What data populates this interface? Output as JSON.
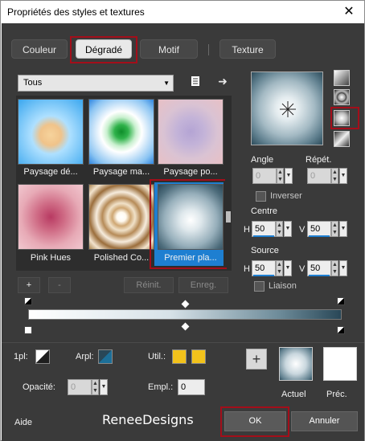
{
  "window": {
    "title": "Propriétés des styles et textures",
    "close_glyph": "✕"
  },
  "tabs": [
    {
      "label": "Couleur"
    },
    {
      "label": "Dégradé"
    },
    {
      "label": "Motif"
    },
    {
      "label": "Texture"
    }
  ],
  "category": {
    "selected": "Tous"
  },
  "gallery": [
    {
      "label": "Paysage dé..."
    },
    {
      "label": "Paysage ma..."
    },
    {
      "label": "Paysage po..."
    },
    {
      "label": "Pink Hues"
    },
    {
      "label": "Polished Co..."
    },
    {
      "label": "Premier pla..."
    }
  ],
  "gallery_buttons": {
    "add": "+",
    "remove": "-",
    "reset": "Réinit.",
    "save": "Enreg."
  },
  "settings": {
    "angle_label": "Angle",
    "angle_value": "0",
    "repeat_label": "Répét.",
    "repeat_value": "0",
    "invert_label": "Inverser",
    "centre_label": "Centre",
    "centre_h": "50",
    "centre_v": "50",
    "source_label": "Source",
    "source_h": "50",
    "source_v": "50",
    "link_label": "Liaison",
    "h": "H",
    "v": "V"
  },
  "bottom": {
    "stop_label": "1pl:",
    "back_label": "Arpl:",
    "util_label": "Util.:",
    "opacity_label": "Opacité:",
    "opacity_value": "0",
    "location_label": "Empl.:",
    "location_value": "0",
    "current_label": "Actuel",
    "previous_label": "Préc.",
    "add_glyph": "+",
    "help_label": "Aide",
    "watermark": "ReneeDesigns",
    "ok_label": "OK",
    "cancel_label": "Annuler"
  },
  "colors": {
    "highlight_red": "#a30e1a",
    "selection_blue": "#1e7fd1",
    "swatch_yellow": "#f2c21b",
    "gradient_dark": "#294757"
  }
}
